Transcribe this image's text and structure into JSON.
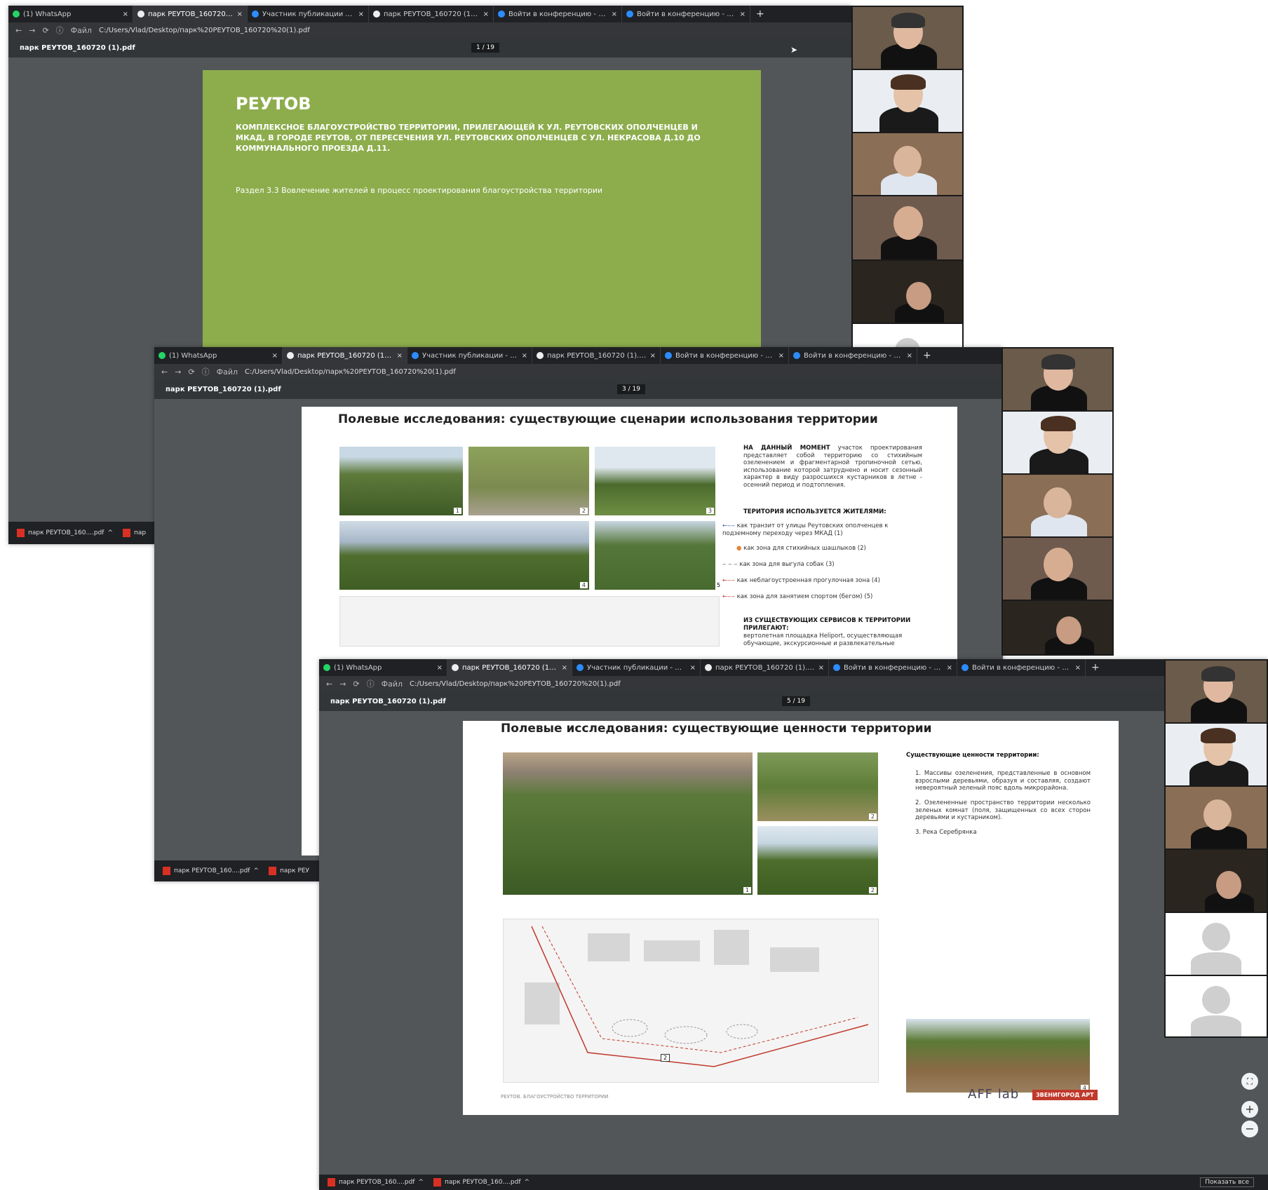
{
  "browser": {
    "tabs": [
      {
        "label": "(1) WhatsApp",
        "icon": "whatsapp-icon",
        "color": "#25d366"
      },
      {
        "label": "парк РЕУТОВ_160720 (1).pdf",
        "icon": "globe-icon",
        "color": "#ffffff"
      },
      {
        "label": "Участник публикации - Zoom",
        "icon": "zoom-icon",
        "color": "#2d8cff"
      },
      {
        "label": "парк РЕУТОВ_160720 (1).pdf",
        "icon": "globe-icon",
        "color": "#ffffff"
      },
      {
        "label": "Войти в конференцию - Zoom",
        "icon": "zoom-icon",
        "color": "#2d8cff"
      },
      {
        "label": "Войти в конференцию - Zoom",
        "icon": "zoom-icon",
        "color": "#2d8cff"
      }
    ],
    "tab_close": "×",
    "new_tab": "+",
    "file_label": "Файл",
    "url1": "C:/Users/Vlad/Desktop/парк%20РЕУТОВ_160720%20(1).pdf",
    "url2": "C:/Users/Vlad/Desktop/парк%20РЕУТОВ_160720%20(1).pdf",
    "url3": "C:/Users/Vlad/Desktop/парк%20РЕУТОВ_160720%20(1).pdf",
    "pdf_filename": "парк РЕУТОВ_160720 (1).pdf",
    "page_indicator_1": "1 / 19",
    "page_indicator_2": "3 / 19",
    "page_indicator_3": "5 / 19",
    "taskbar_item": "парк РЕУТОВ_160....pdf",
    "taskbar_item_short": "пар",
    "taskbar_item_short2": "парк РЕУ",
    "show_all": "Показать все"
  },
  "slide1": {
    "title": "РЕУТОВ",
    "subtitle": "КОМПЛЕКСНОЕ БЛАГОУСТРОЙСТВО ТЕРРИТОРИИ, ПРИЛЕГАЮЩЕЙ К УЛ. РЕУТОВСКИХ ОПОЛЧЕНЦЕВ И МКАД, В ГОРОДЕ РЕУТОВ, ОТ ПЕРЕСЕЧЕНИЯ УЛ. РЕУТОВСКИХ ОПОЛЧЕНЦЕВ С УЛ. НЕКРАСОВА Д.10 ДО КОММУНАЛЬНОГО ПРОЕЗДА Д.11.",
    "section": "Раздел 3.3 Вовлечение жителей в процесс проектирования благоустройства территории"
  },
  "slide2": {
    "title": "Полевые исследования: существующие сценарии использования территории",
    "intro_bold": "НА ДАННЫЙ МОМЕНТ",
    "intro": "участок проектирования представляет собой территорию со стихийным озеленением и фрагментарной тропиночной сетью, использование которой затруднено и носит сезонный характер в виду разросшихся кустарников в летне - осенний период и подтопления.",
    "uses_heading": "ТЕРИТОРИЯ ИСПОЛЬЗУЕТСЯ ЖИТЕЛЯМИ:",
    "uses": [
      "как транзит от улицы Реутовских ополченцев к подземному переходу через МКАД (1)",
      "как зона для стихийных шашлыков (2)",
      "как зона для выгула собак (3)",
      "как неблагоустроенная прогулочная зона (4)",
      "как зона для занятием спортом (бегом) (5)"
    ],
    "services_heading": "ИЗ СУЩЕСТВУЮЩИХ СЕРВИСОВ К ТЕРРИТОРИИ ПРИЛЕГАЮТ:",
    "services": "вертолетная площадка Heliport, осуществляющая обучающие, экскурсионные и развлекательные",
    "photo_nums": [
      "1",
      "2",
      "3",
      "4",
      "5"
    ]
  },
  "slide3": {
    "title": "Полевые исследования: существующие ценности территории",
    "values_heading": "Существующие ценности территории:",
    "values": [
      "1. Массивы озеленения, представленные в основном взрослыми деревьями, образуя и составляя, создают невероятный зеленый пояс вдоль микрорайона.",
      "2. Озелененные пространство территории несколько зеленых комнат (поля, защищенных со всех сторон деревьями и кустарником).",
      "3. Река Серебрянка"
    ],
    "photo_nums": [
      "1",
      "2",
      "2",
      "3",
      "4"
    ],
    "map_num": "2",
    "footer": "РЕУТОВ. БЛАГОУСТРОЙСТВО ТЕРРИТОРИИ",
    "logo1": "AFF lab",
    "logo2": "ЗВЕНИГОРОД АРТ"
  },
  "zoom_controls": {
    "fit": "⛶",
    "zoom_in": "+",
    "zoom_out": "−"
  }
}
